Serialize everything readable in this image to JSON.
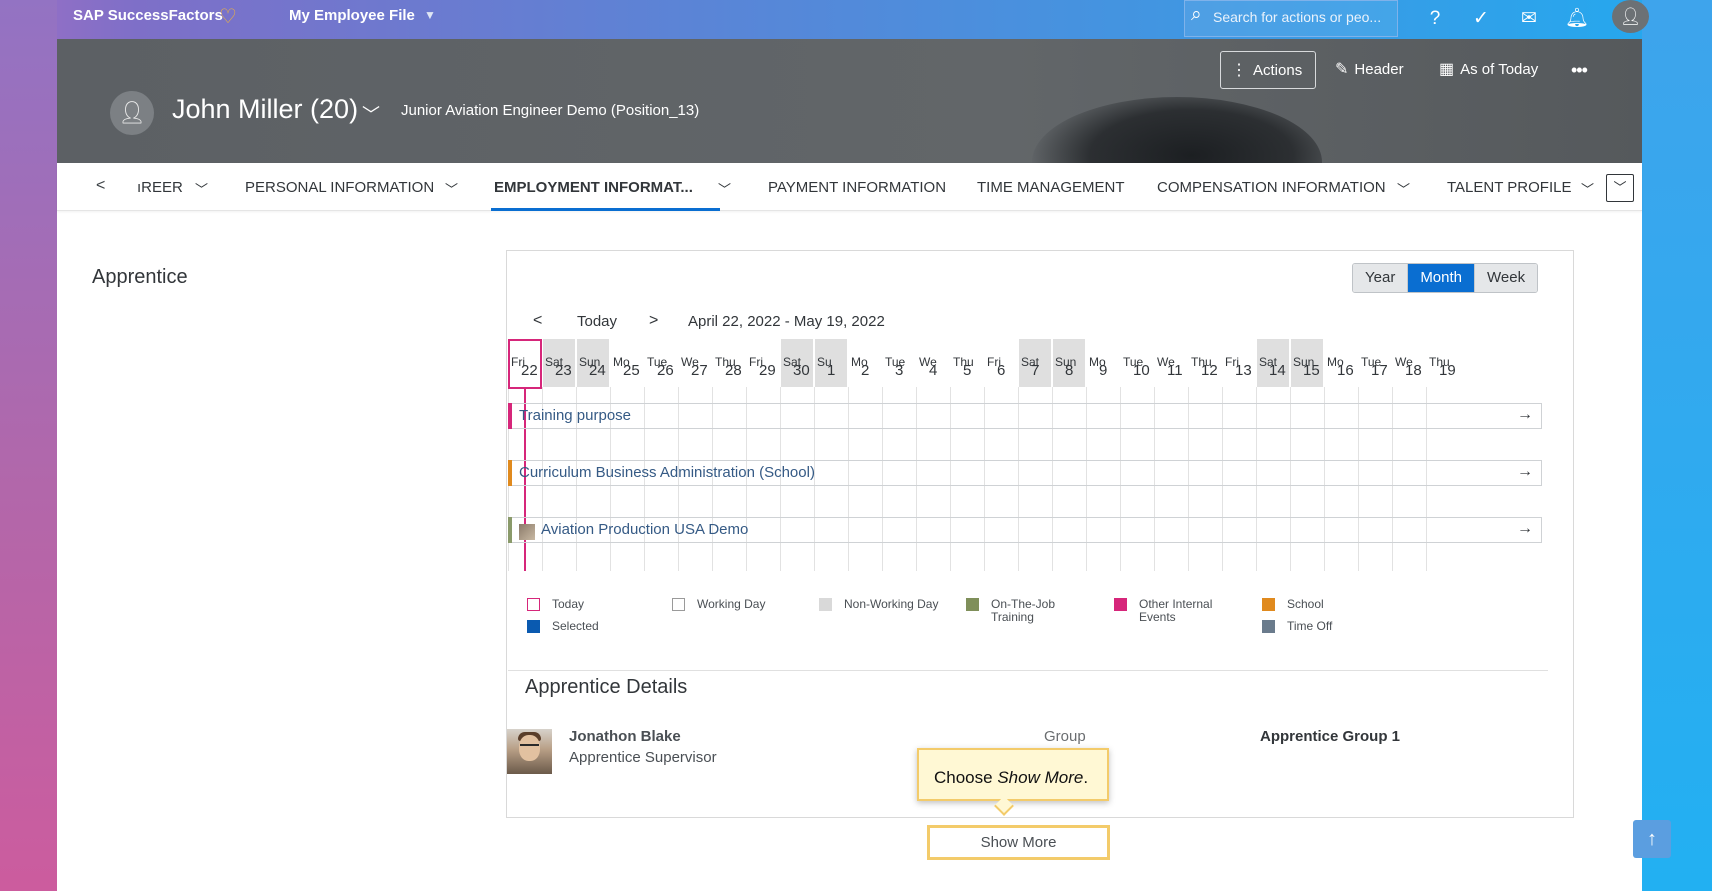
{
  "shell": {
    "brand": "SAP SuccessFactors",
    "module": "My Employee File",
    "search_placeholder": "Search for actions or peo..."
  },
  "header": {
    "employee_name": "John Miller (20)",
    "position": "Junior Aviation Engineer Demo (Position_13)",
    "actions_label": "Actions",
    "header_label": "Header",
    "as_of_label": "As of Today",
    "more_label": "•••"
  },
  "tabs": {
    "items": [
      {
        "label": "ıREER"
      },
      {
        "label": "PERSONAL INFORMATION"
      },
      {
        "label": "EMPLOYMENT INFORMAT..."
      },
      {
        "label": "PAYMENT INFORMATION"
      },
      {
        "label": "TIME MANAGEMENT"
      },
      {
        "label": "COMPENSATION INFORMATION"
      },
      {
        "label": "TALENT PROFILE"
      }
    ],
    "active": "EMPLOYMENT INFORMAT..."
  },
  "section": {
    "title": "Apprentice"
  },
  "calendar": {
    "views": [
      "Year",
      "Month",
      "Week"
    ],
    "selected_view": "Month",
    "today_label": "Today",
    "range": "April 22, 2022 - May 19, 2022",
    "days": [
      {
        "wd": "Fri",
        "d": "22",
        "nw": false
      },
      {
        "wd": "Sat",
        "d": "23",
        "nw": true
      },
      {
        "wd": "Sun",
        "d": "24",
        "nw": true
      },
      {
        "wd": "Mo",
        "d": "25",
        "nw": false
      },
      {
        "wd": "Tue",
        "d": "26",
        "nw": false
      },
      {
        "wd": "We",
        "d": "27",
        "nw": false
      },
      {
        "wd": "Thu",
        "d": "28",
        "nw": false
      },
      {
        "wd": "Fri",
        "d": "29",
        "nw": false
      },
      {
        "wd": "Sat",
        "d": "30",
        "nw": true
      },
      {
        "wd": "Su",
        "d": "1",
        "nw": true
      },
      {
        "wd": "Mo",
        "d": "2",
        "nw": false
      },
      {
        "wd": "Tue",
        "d": "3",
        "nw": false
      },
      {
        "wd": "We",
        "d": "4",
        "nw": false
      },
      {
        "wd": "Thu",
        "d": "5",
        "nw": false
      },
      {
        "wd": "Fri",
        "d": "6",
        "nw": false
      },
      {
        "wd": "Sat",
        "d": "7",
        "nw": true
      },
      {
        "wd": "Sun",
        "d": "8",
        "nw": true
      },
      {
        "wd": "Mo",
        "d": "9",
        "nw": false
      },
      {
        "wd": "Tue",
        "d": "10",
        "nw": false
      },
      {
        "wd": "We",
        "d": "11",
        "nw": false
      },
      {
        "wd": "Thu",
        "d": "12",
        "nw": false
      },
      {
        "wd": "Fri",
        "d": "13",
        "nw": false
      },
      {
        "wd": "Sat",
        "d": "14",
        "nw": true
      },
      {
        "wd": "Sun",
        "d": "15",
        "nw": true
      },
      {
        "wd": "Mo",
        "d": "16",
        "nw": false
      },
      {
        "wd": "Tue",
        "d": "17",
        "nw": false
      },
      {
        "wd": "We",
        "d": "18",
        "nw": false
      },
      {
        "wd": "Thu",
        "d": "19",
        "nw": false
      }
    ],
    "rows": [
      {
        "label": "Training purpose",
        "color": "#d6267a"
      },
      {
        "label": "Curriculum Business Administration (School)",
        "color": "#e08a1e"
      },
      {
        "label": "Aviation Production USA Demo",
        "color": "#8a9a6a"
      }
    ],
    "legend": [
      {
        "label": "Today",
        "color": "#d6267a",
        "outline": true
      },
      {
        "label": "Selected",
        "color": "#0a5ab0",
        "outline": false
      },
      {
        "label": "Working Day",
        "color": "#9a9a9a",
        "outline": true
      },
      {
        "label": "Non-Working Day",
        "color": "#d9d9d9",
        "outline": false
      },
      {
        "label": "On-The-Job Training",
        "color": "#7f8f5a",
        "outline": false
      },
      {
        "label": "Other Internal Events",
        "color": "#d6267a",
        "outline": false
      },
      {
        "label": "School",
        "color": "#e08a1e",
        "outline": false
      },
      {
        "label": "Time Off",
        "color": "#6a7b8c",
        "outline": false
      }
    ]
  },
  "details": {
    "title": "Apprentice Details",
    "supervisor_name": "Jonathon Blake",
    "supervisor_role": "Apprentice Supervisor",
    "group_label": "Group",
    "group_value": "Apprentice Group 1"
  },
  "callout": {
    "prefix": "Choose ",
    "emphasis": "Show More",
    "suffix": "."
  },
  "show_more_label": "Show More",
  "colors": {
    "accent": "#0a6ed1",
    "today": "#d6267a",
    "highlight": "#f3cb6a"
  }
}
